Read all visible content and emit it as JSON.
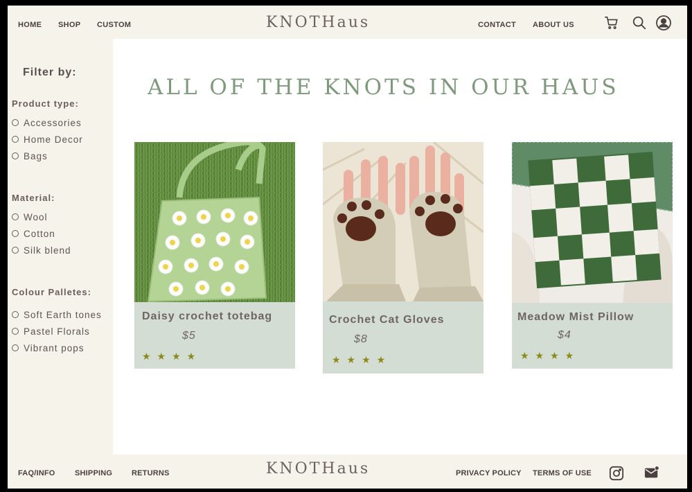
{
  "header": {
    "nav_left": [
      "HOME",
      "SHOP",
      "CUSTOM"
    ],
    "brand": "KNOTHaus",
    "nav_right": [
      "CONTACT",
      "ABOUT US"
    ],
    "icons": [
      "cart-icon",
      "search-icon",
      "account-icon"
    ]
  },
  "sidebar": {
    "title": "Filter by:",
    "groups": [
      {
        "title": "Product type:",
        "options": [
          "Accessories",
          "Home Decor",
          "Bags"
        ]
      },
      {
        "title": "Material:",
        "options": [
          "Wool",
          "Cotton",
          "Silk blend"
        ]
      },
      {
        "title": "Colour Palletes:",
        "options": [
          "Soft Earth tones",
          "Pastel Florals",
          "Vibrant pops"
        ]
      }
    ]
  },
  "main": {
    "title": "ALL OF THE KNOTS IN OUR HAUS",
    "products": [
      {
        "name": "Daisy crochet totebag",
        "price": "$5",
        "stars": "★★★★",
        "rating": 4
      },
      {
        "name": "Crochet Cat Gloves",
        "price": "$8",
        "stars": "★★★★",
        "rating": 4
      },
      {
        "name": "Meadow Mist Pillow",
        "price": "$4",
        "stars": "★★★★",
        "rating": 4
      }
    ]
  },
  "footer": {
    "links_left": [
      "FAQ/INFO",
      "SHIPPING",
      "RETURNS"
    ],
    "brand": "KNOTHaus",
    "links_right": [
      "PRIVACY POLICY",
      "TERMS OF USE"
    ],
    "icons": [
      "instagram-icon",
      "mail-icon"
    ]
  },
  "colors": {
    "accent_green": "#7d9a7b",
    "card_bg": "#d3ddd3",
    "cream": "#f6f3ea",
    "star": "#8a8a1a"
  }
}
